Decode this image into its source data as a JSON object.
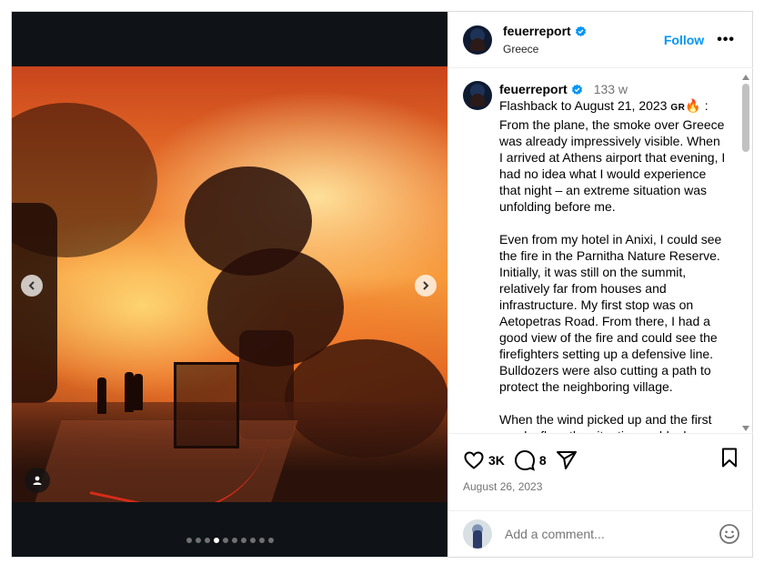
{
  "post": {
    "username": "feuerreport",
    "location": "Greece",
    "follow_label": "Follow",
    "more_label": "•••",
    "time_ago": "133 w",
    "caption_intro": "Flashback to August 21, 2023",
    "caption_flag": "GR",
    "caption_fire": "🔥",
    "caption_colon": ":",
    "caption_p1_rest": "From the plane, the smoke over Greece was already impressively visible. When I arrived at Athens airport that evening, I had no idea what I would experience that night – an extreme situation was unfolding before me.",
    "caption_p2": "Even from my hotel in Anixi, I could see the fire in the Parnitha Nature Reserve. Initially, it was still on the summit, relatively far from houses and infrastructure. My first stop was on Aetopetras Road. From there, I had a good view of the fire and could see the firefighters setting up a defensive line. Bulldozers were also cutting a path to protect the neighboring village.",
    "caption_p3": "When the wind picked up and the first sparks flew, the situation suddenly",
    "likes": "3K",
    "comments": "8",
    "date": "August 26, 2023",
    "comment_placeholder": "Add a comment..."
  },
  "carousel": {
    "total": 10,
    "active_index": 3
  },
  "colors": {
    "accent": "#0095f6",
    "verified": "#0095f6",
    "muted": "#737373"
  },
  "icons": [
    "verified-badge-icon",
    "more-options-icon",
    "heart-icon",
    "comment-icon",
    "share-icon",
    "bookmark-icon",
    "emoji-icon",
    "chevron-left-icon",
    "chevron-right-icon",
    "user-tag-icon"
  ]
}
